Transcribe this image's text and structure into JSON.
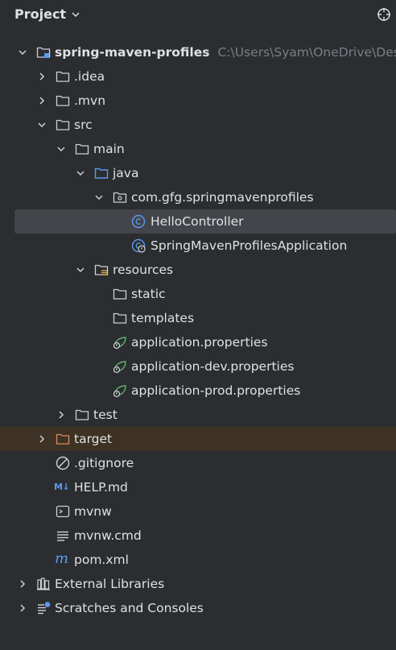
{
  "panel": {
    "title": "Project",
    "colors": {
      "background": "#2b2d30",
      "selected": "#43454a",
      "excluded": "#3d3223",
      "accent": "#5a9bf0",
      "spring": "#5fb66a"
    }
  },
  "tree": {
    "root": {
      "name": "spring-maven-profiles",
      "path": "C:\\Users\\Syam\\OneDrive\\Des"
    },
    "idea": ".idea",
    "mvn": ".mvn",
    "src": "src",
    "main": "main",
    "java": "java",
    "package": "com.gfg.springmavenprofiles",
    "hello_controller": "HelloController",
    "app_class": "SpringMavenProfilesApplication",
    "resources": "resources",
    "static": "static",
    "templates": "templates",
    "app_props": "application.properties",
    "app_dev_props": "application-dev.properties",
    "app_prod_props": "application-prod.properties",
    "test": "test",
    "target": "target",
    "gitignore": ".gitignore",
    "help": "HELP.md",
    "help_badge": "M↓",
    "mvnw": "mvnw",
    "mvnw_cmd": "mvnw.cmd",
    "pom": "pom.xml",
    "pom_badge": "m",
    "ext_libs": "External Libraries",
    "scratches": "Scratches and Consoles"
  }
}
